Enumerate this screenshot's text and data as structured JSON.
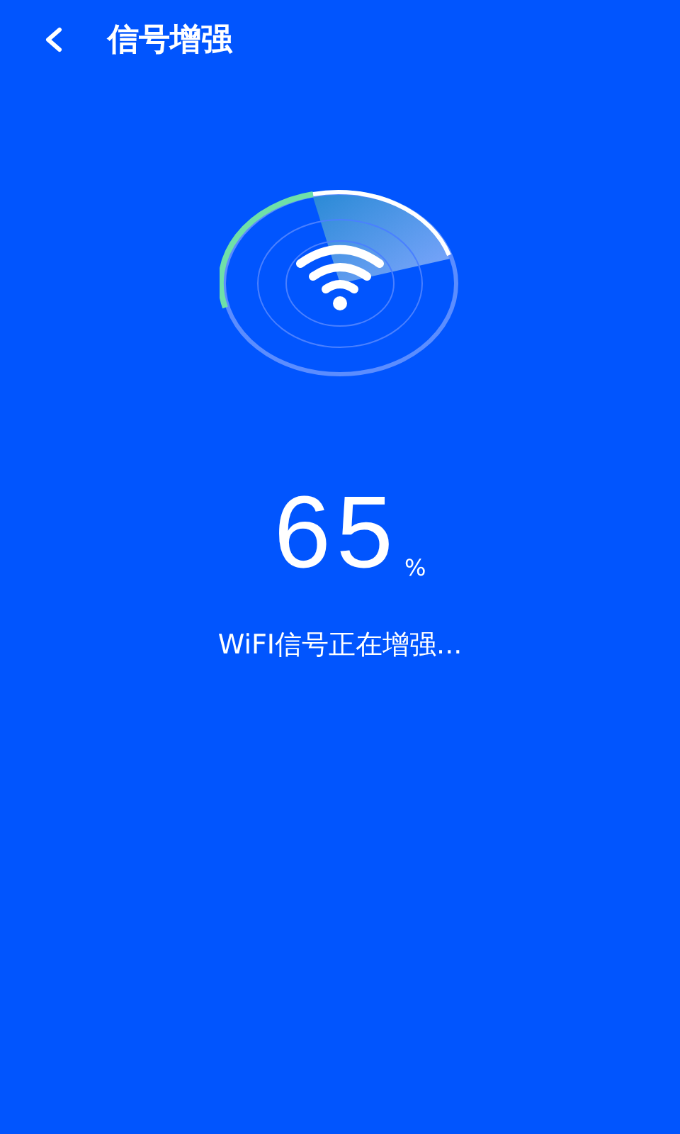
{
  "header": {
    "title": "信号增强"
  },
  "progress": {
    "value": "65",
    "unit": "%",
    "status": "WiFI信号正在增强..."
  }
}
